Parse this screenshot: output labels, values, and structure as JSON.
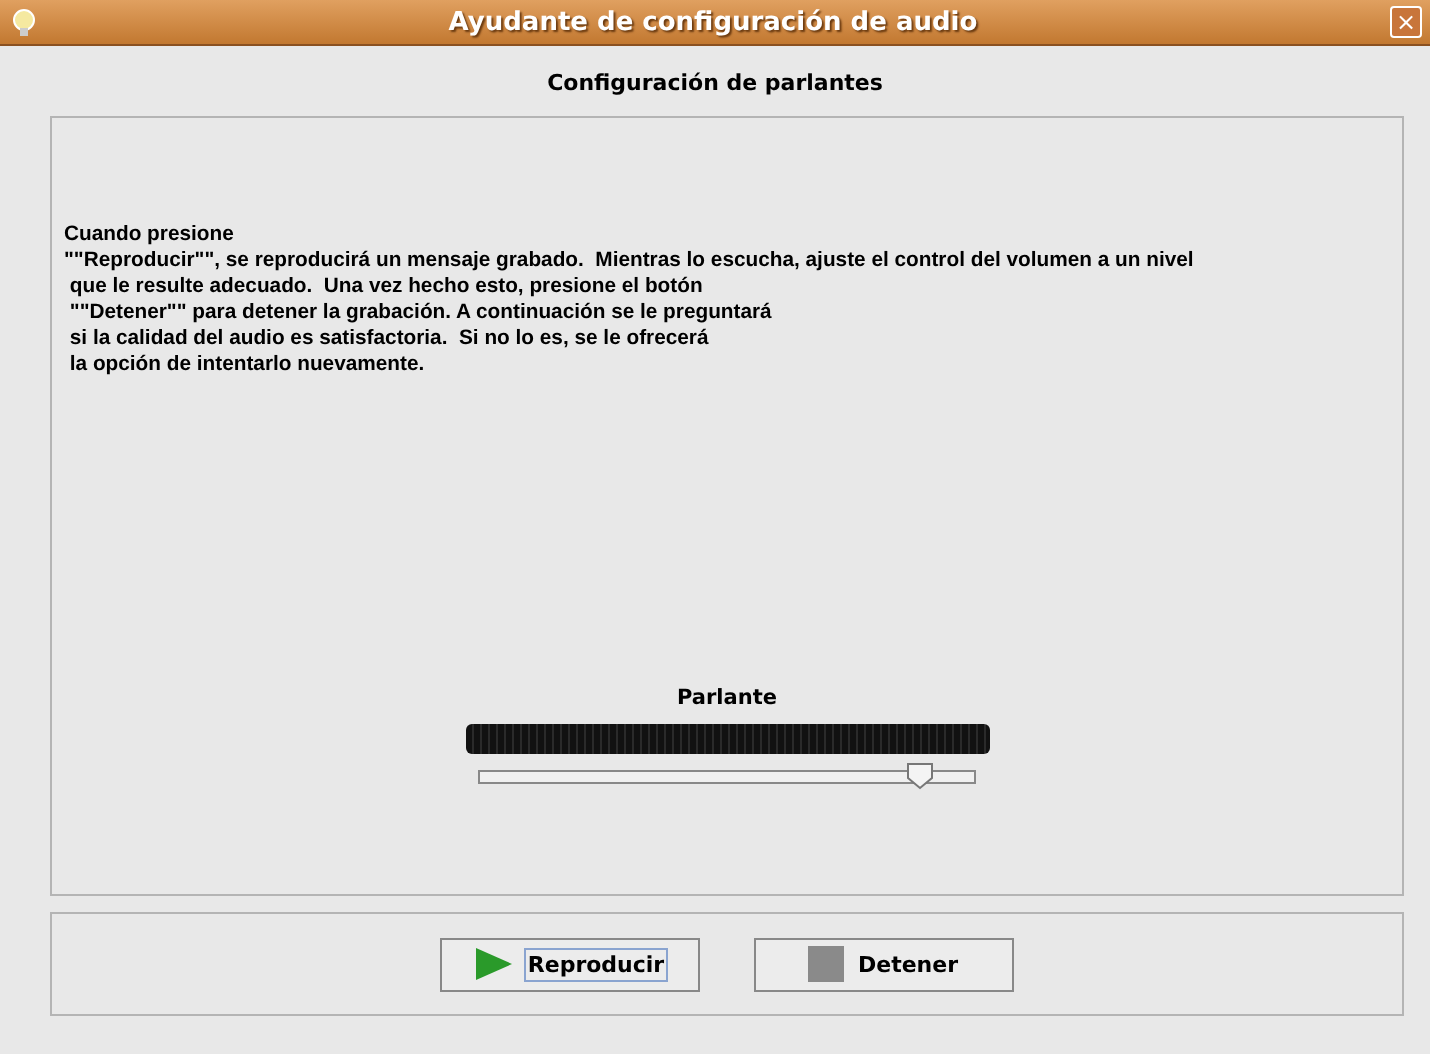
{
  "window": {
    "title": "Ayudante de configuración de audio",
    "close": "×"
  },
  "header": "Configuración de parlantes",
  "instructions": [
    "Cuando presione",
    "\"\"Reproducir\"\", se reproducirá un mensaje grabado.  Mientras lo escucha, ajuste el control del volumen a un nivel",
    " que le resulte adecuado.  Una vez hecho esto, presione el botón",
    " \"\"Detener\"\" para detener la grabación. A continuación se le preguntará",
    " si la calidad del audio es satisfactoria.  Si no lo es, se le ofrecerá",
    " la opción de intentarlo nuevamente."
  ],
  "speaker": {
    "label": "Parlante",
    "volume": {
      "level": 0.89
    }
  },
  "buttons": [
    {
      "kind": "play",
      "label": "Reproducir",
      "focused": true
    },
    {
      "kind": "stop",
      "label": "Detener",
      "focused": false
    }
  ]
}
